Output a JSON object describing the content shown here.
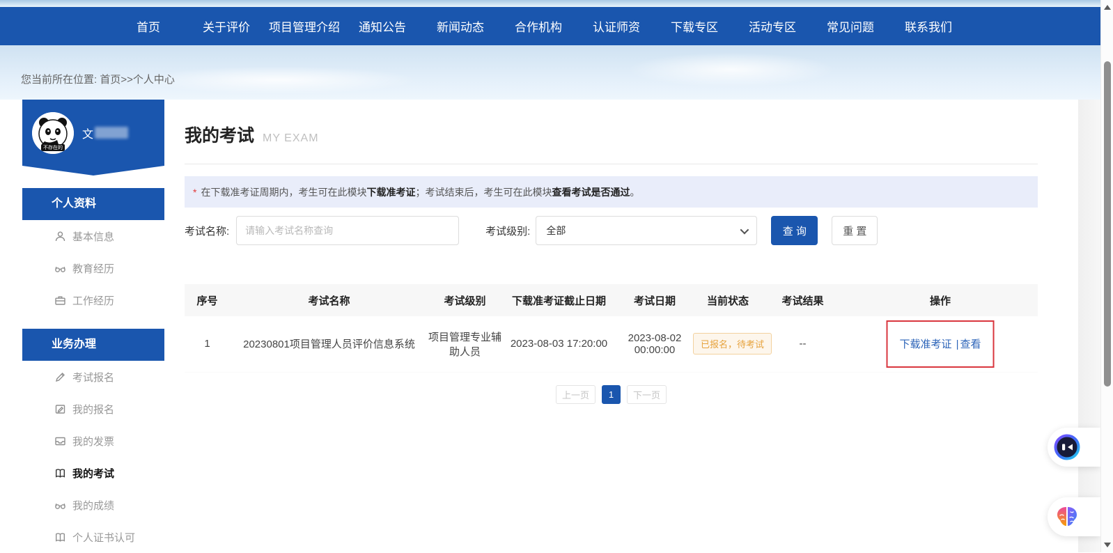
{
  "nav": {
    "items": [
      {
        "label": "首页"
      },
      {
        "label": "关于评价"
      },
      {
        "label": "项目管理介绍"
      },
      {
        "label": "通知公告"
      },
      {
        "label": "新闻动态"
      },
      {
        "label": "合作机构"
      },
      {
        "label": "认证师资"
      },
      {
        "label": "下载专区"
      },
      {
        "label": "活动专区"
      },
      {
        "label": "常见问题"
      },
      {
        "label": "联系我们"
      }
    ]
  },
  "breadcrumb": {
    "text": "您当前所在位置: 首页>>个人中心"
  },
  "sidebar": {
    "user": {
      "name": "文",
      "avatar_caption": "不存在的",
      "avatar_icon": "panda-avatar"
    },
    "sections": [
      {
        "title": "个人资料",
        "items": [
          {
            "label": "基本信息",
            "icon": "user-icon"
          },
          {
            "label": "教育经历",
            "icon": "glasses-icon"
          },
          {
            "label": "工作经历",
            "icon": "briefcase-icon"
          }
        ]
      },
      {
        "title": "业务办理",
        "items": [
          {
            "label": "考试报名",
            "icon": "pencil-icon"
          },
          {
            "label": "我的报名",
            "icon": "edit-note-icon"
          },
          {
            "label": "我的发票",
            "icon": "invoice-icon"
          },
          {
            "label": "我的考试",
            "icon": "book-icon",
            "active": true
          },
          {
            "label": "我的成绩",
            "icon": "glasses-icon"
          },
          {
            "label": "个人证书认可",
            "icon": "book-icon"
          }
        ]
      }
    ]
  },
  "main": {
    "title": "我的考试",
    "subtitle": "MY EXAM",
    "notice": {
      "asterisk": "*",
      "part1": "在下载准考证周期内，考生可在此模块 ",
      "bold1": "下载准考证",
      "part2": "；考试结束后，考生可在此模块 ",
      "bold2": "查看考试是否通过",
      "part3": "。"
    },
    "filters": {
      "name_label": "考试名称:",
      "name_placeholder": "请输入考试名称查询",
      "level_label": "考试级别:",
      "level_value": "全部",
      "search_button": "查 询",
      "reset_button": "重 置"
    },
    "table": {
      "headers": [
        "序号",
        "考试名称",
        "考试级别",
        "下载准考证截止日期",
        "考试日期",
        "当前状态",
        "考试结果",
        "操作"
      ],
      "rows": [
        {
          "seq": "1",
          "exam_name": "20230801项目管理人员评价信息系统",
          "exam_level": "项目管理专业辅助人员",
          "ticket_deadline": "2023-08-03 17:20:00",
          "exam_date": "2023-08-02 00:00:00",
          "status": "已报名，待考试",
          "result": "--",
          "action_download": "下载准考证",
          "action_separator": "|",
          "action_view": "查看"
        }
      ]
    },
    "pagination": {
      "prev": "上一页",
      "current": "1",
      "next": "下一页"
    }
  },
  "floating": {
    "buttons": [
      {
        "icon": "ai-robot-icon"
      },
      {
        "icon": "ai-brain-icon"
      }
    ]
  },
  "colors": {
    "accent_blue": "#1a56ae",
    "link_blue": "#2b63b8",
    "highlight_red": "#d9363e",
    "badge_text": "#e6a23c",
    "badge_bg": "#fdf6ec",
    "badge_border": "#f3d19e"
  }
}
